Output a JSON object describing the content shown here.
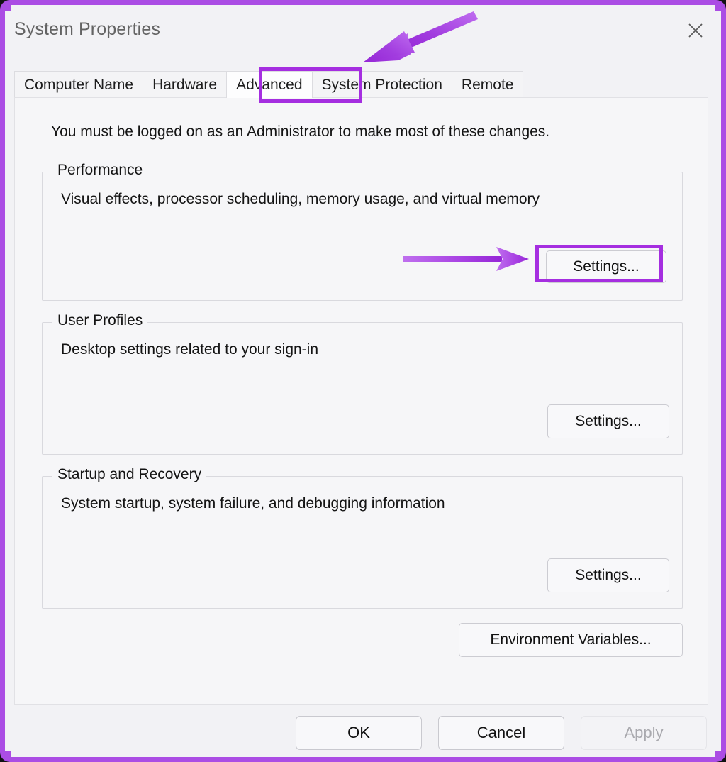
{
  "window": {
    "title": "System Properties",
    "close_label": "✕",
    "accent_color": "#a52ee0",
    "frame_color": "#ab4de4"
  },
  "tabs": [
    {
      "label": "Computer Name",
      "active": false
    },
    {
      "label": "Hardware",
      "active": false
    },
    {
      "label": "Advanced",
      "active": true
    },
    {
      "label": "System Protection",
      "active": false
    },
    {
      "label": "Remote",
      "active": false
    }
  ],
  "content": {
    "admin_note": "You must be logged on as an Administrator to make most of these changes.",
    "groups": [
      {
        "legend": "Performance",
        "description": "Visual effects, processor scheduling, memory usage, and virtual memory",
        "button_label": "Settings...",
        "highlighted": true
      },
      {
        "legend": "User Profiles",
        "description": "Desktop settings related to your sign-in",
        "button_label": "Settings...",
        "highlighted": false
      },
      {
        "legend": "Startup and Recovery",
        "description": "System startup, system failure, and debugging information",
        "button_label": "Settings...",
        "highlighted": false
      }
    ],
    "environment_variables_label": "Environment Variables..."
  },
  "footer": {
    "ok_label": "OK",
    "cancel_label": "Cancel",
    "apply_label": "Apply",
    "apply_disabled": true
  },
  "annotations": [
    {
      "name": "arrow-to-advanced-tab",
      "type": "arrow",
      "color": "#a52ee0"
    },
    {
      "name": "arrow-to-performance-settings",
      "type": "arrow",
      "color": "#a52ee0"
    },
    {
      "name": "highlight-advanced-tab",
      "type": "box",
      "color": "#a52ee0"
    },
    {
      "name": "highlight-performance-settings",
      "type": "box",
      "color": "#a52ee0"
    }
  ]
}
